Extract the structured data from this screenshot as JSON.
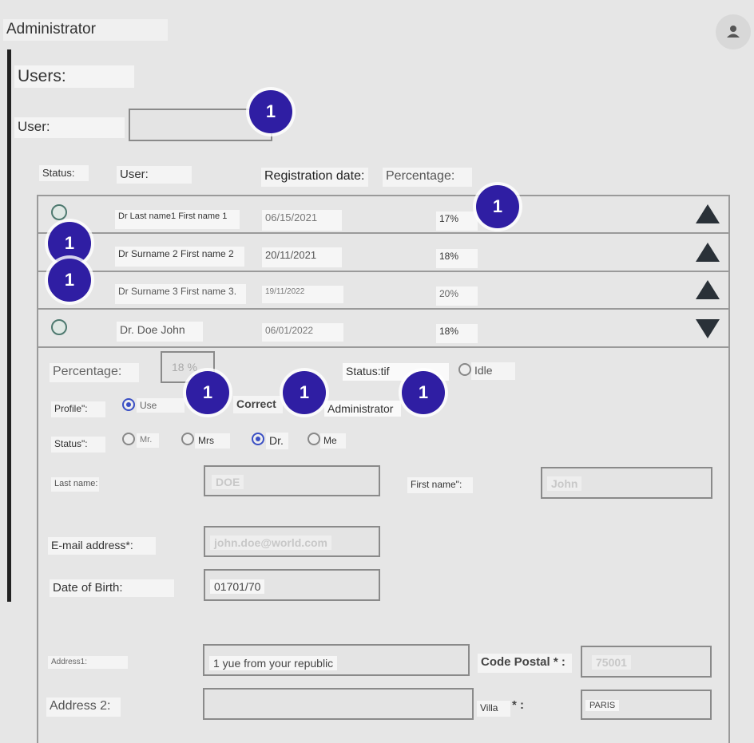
{
  "header": {
    "app_title": "Administrator",
    "avatar_icon": "user-icon"
  },
  "page": {
    "heading": "Users:",
    "filter_label": "User:",
    "filter_value": ""
  },
  "table": {
    "headers": {
      "status": "Status:",
      "user": "User:",
      "registration": "Registration date:",
      "percentage": "Percentage:"
    },
    "rows": [
      {
        "name": "Dr Last name1 First name 1",
        "date": "06/15/2021",
        "pct": "17%",
        "sort": "up"
      },
      {
        "name": "Dr Surname 2 First name 2",
        "date": "20/11/2021",
        "pct": "18%",
        "sort": "up"
      },
      {
        "name": "Dr Surname 3 First name 3.",
        "date": "19/11/2022",
        "pct": "20%",
        "sort": "up"
      },
      {
        "name": "Dr. Doe John",
        "date": "06/01/2022",
        "pct": "18%",
        "sort": "down"
      }
    ]
  },
  "detail": {
    "percentage_label": "Percentage:",
    "percentage_value": "18 %",
    "status_top_label": "Status:tif",
    "idle_label": "Idle",
    "profile_label": "Profile\":",
    "profile_options": [
      "Use",
      "Correct",
      "Administrator"
    ],
    "title_label": "Status\":",
    "title_options": [
      "Mr.",
      "Mrs",
      "Dr.",
      "Me"
    ],
    "last_name_label": "Last name:",
    "last_name_value": "DOE",
    "first_name_label": "First name\":",
    "first_name_value": "John",
    "email_label": "E-mail address*:",
    "email_value": "john.doe@world.com",
    "dob_label": "Date of Birth:",
    "dob_value": "01701/70",
    "address1_label": "Address1:",
    "address1_value": "1 yue from your republic",
    "postal_label": "Code Postal * :",
    "postal_value": "75001",
    "address2_label": "Address 2:",
    "address2_value": "",
    "city_label": "Villa",
    "city_colon": "* :",
    "city_value": "PARIS"
  },
  "annotations": {
    "badge_text": "1",
    "badge_color": "#2f1ea3"
  }
}
